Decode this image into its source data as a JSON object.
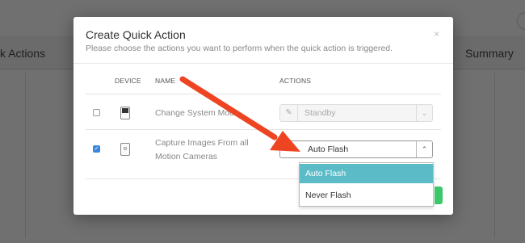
{
  "background": {
    "left_header": "k Actions",
    "right_header": "Summary"
  },
  "modal": {
    "title": "Create Quick Action",
    "subtitle": "Please choose the actions you want to perform when the quick action is triggered.",
    "close_glyph": "×",
    "columns": {
      "device": "DEVICE",
      "name": "NAME",
      "actions": "ACTIONS"
    },
    "rows": [
      {
        "checked": false,
        "device_icon": "hub-device-icon",
        "name": "Change System Mode",
        "action_value": "Standby",
        "action_disabled": true
      },
      {
        "checked": true,
        "device_icon": "camera-device-icon",
        "name_line1": "Capture Images From all",
        "name_line2": "Motion Cameras",
        "action_value": "Auto Flash",
        "action_disabled": false
      }
    ],
    "dropdown_options": [
      "Auto Flash",
      "Never Flash"
    ],
    "dropdown_selected": "Auto Flash"
  },
  "glyphs": {
    "check": "✓",
    "chevron": "⌄",
    "chevron_up": "⌃",
    "edit": "✎"
  },
  "colors": {
    "accent": "#5bbcc8",
    "checkbox": "#3a87e0",
    "green_button": "#3cc86a",
    "arrow": "#ee4422"
  }
}
